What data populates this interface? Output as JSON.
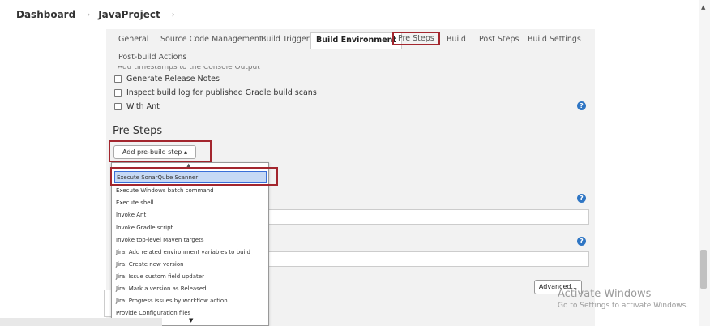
{
  "breadcrumb": {
    "items": [
      "Dashboard",
      "JavaProject"
    ],
    "separator": "›"
  },
  "tabs": [
    {
      "label": "General",
      "state": "normal"
    },
    {
      "label": "Source Code Management",
      "state": "normal"
    },
    {
      "label": "Build Triggers",
      "state": "normal"
    },
    {
      "label": "Build Environment",
      "state": "active"
    },
    {
      "label": "Pre Steps",
      "state": "highlighted"
    },
    {
      "label": "Build",
      "state": "normal"
    },
    {
      "label": "Post Steps",
      "state": "normal"
    },
    {
      "label": "Build Settings",
      "state": "normal"
    },
    {
      "label": "Post-build Actions",
      "state": "normal"
    }
  ],
  "build_env": {
    "cut_off_text": "Add timestamps to the Console Output",
    "checkboxes": [
      {
        "label": "Generate Release Notes",
        "checked": false
      },
      {
        "label": "Inspect build log for published Gradle build scans",
        "checked": false
      },
      {
        "label": "With Ant",
        "checked": false
      }
    ]
  },
  "pre_steps": {
    "title": "Pre Steps",
    "add_button": "Add pre-build step ▴",
    "menu_items": [
      "Execute SonarQube Scanner",
      "Execute Windows batch command",
      "Execute shell",
      "Invoke Ant",
      "Invoke Gradle script",
      "Invoke top-level Maven targets",
      "Jira: Add related environment variables to build",
      "Jira: Create new version",
      "Jira: Issue custom field updater",
      "Jira: Mark a version as Released",
      "Jira: Progress issues by workflow action",
      "Provide Configuration files"
    ],
    "selected_item": "Execute SonarQube Scanner"
  },
  "advanced_button": "Advanced...",
  "help_icon_text": "?",
  "watermark": {
    "title": "Activate Windows",
    "subtitle": "Go to Settings to activate Windows."
  },
  "colors": {
    "highlight_border": "#a3262e",
    "help_blue": "#2f76c4",
    "panel_bg": "#f2f2f2",
    "selection_bg": "#c6d9f5"
  }
}
